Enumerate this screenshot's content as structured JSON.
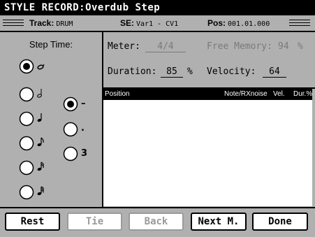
{
  "title": "STYLE RECORD:Overdub Step",
  "header": {
    "track_label": "Track:",
    "track_value": "DRUM",
    "se_label": "SE:",
    "se_value": "Var1 - CV1",
    "pos_label": "Pos:",
    "pos_value": "001.01.000"
  },
  "step_time": {
    "title": "Step Time:",
    "selected": "half",
    "notes": [
      "half",
      "quarter",
      "quarter-bold",
      "eighth",
      "sixteenth",
      "thirty-second"
    ],
    "modifiers": {
      "selected": "normal",
      "dot_label": ".",
      "triplet_label": "3",
      "normal_label": "–"
    }
  },
  "fields": {
    "meter_label": "Meter:",
    "meter_value": "4/4",
    "free_memory_label": "Free Memory:",
    "free_memory_value": "94",
    "free_memory_unit": "%",
    "duration_label": "Duration:",
    "duration_value": "85",
    "duration_unit": "%",
    "velocity_label": "Velocity:",
    "velocity_value": "64"
  },
  "list": {
    "columns": [
      "Position",
      "Note/RXnoise",
      "Vel.",
      "Dur.%"
    ],
    "rows": []
  },
  "buttons": [
    {
      "label": "Rest",
      "enabled": true
    },
    {
      "label": "Tie",
      "enabled": false
    },
    {
      "label": "Back",
      "enabled": false
    },
    {
      "label": "Next M.",
      "enabled": true
    },
    {
      "label": "Done",
      "enabled": true
    }
  ],
  "colors": {
    "background": "#b0b0b0",
    "title_bar": "#000000",
    "list_area": "#ffffff",
    "disabled_text": "#9a9a9a"
  }
}
